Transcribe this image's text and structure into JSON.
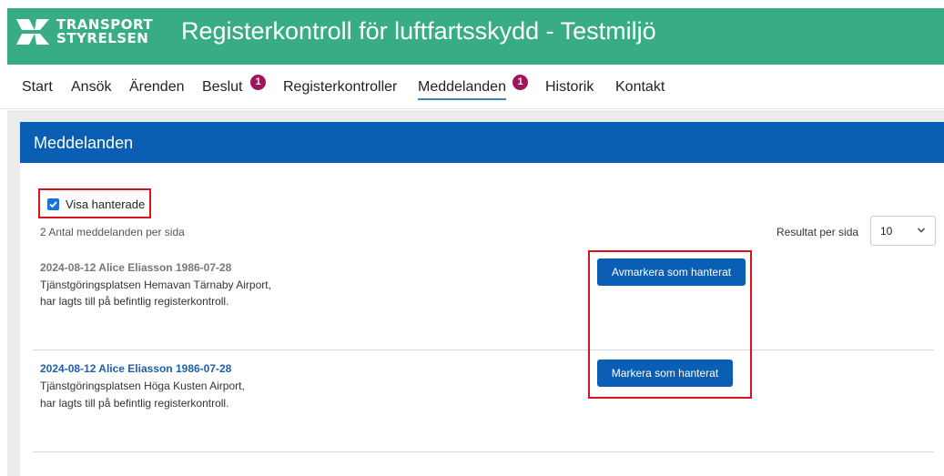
{
  "header": {
    "logo_line1": "TRANSPORT",
    "logo_line2": "STYRELSEN",
    "app_title": "Registerkontroll för luftfartsskydd - Testmiljö"
  },
  "nav": {
    "items": [
      {
        "label": "Start"
      },
      {
        "label": "Ansök"
      },
      {
        "label": "Ärenden"
      },
      {
        "label": "Beslut",
        "badge": "1"
      },
      {
        "label": "Registerkontroller"
      },
      {
        "label": "Meddelanden",
        "badge": "1",
        "active": true
      },
      {
        "label": "Historik"
      },
      {
        "label": "Kontakt"
      }
    ]
  },
  "panel": {
    "title": "Meddelanden",
    "show_handled_label": "Visa hanterade",
    "show_handled_checked": true,
    "count_number": "2",
    "count_text": "Antal meddelanden per sida",
    "per_page_label": "Resultat per sida",
    "per_page_value": "10"
  },
  "messages": [
    {
      "header": "2024-08-12 Alice Eliasson 1986-07-28",
      "line1": "Tjänstgöringsplatsen Hemavan Tärnaby Airport,",
      "line2": "har lagts till på befintlig registerkontroll.",
      "button_label": "Avmarkera som hanterat",
      "handled": true
    },
    {
      "header": "2024-08-12 Alice Eliasson 1986-07-28",
      "line1": "Tjänstgöringsplatsen Höga Kusten Airport,",
      "line2": "har lagts till på befintlig registerkontroll.",
      "button_label": "Markera som hanterat",
      "handled": false
    }
  ],
  "colors": {
    "header_green": "#38ad83",
    "panel_blue": "#0a5fb4",
    "badge_magenta": "#a4125a",
    "highlight_red": "#d9121c",
    "handled_header_gray": "#777777",
    "unhandled_header_blue": "#1f5fa8"
  }
}
